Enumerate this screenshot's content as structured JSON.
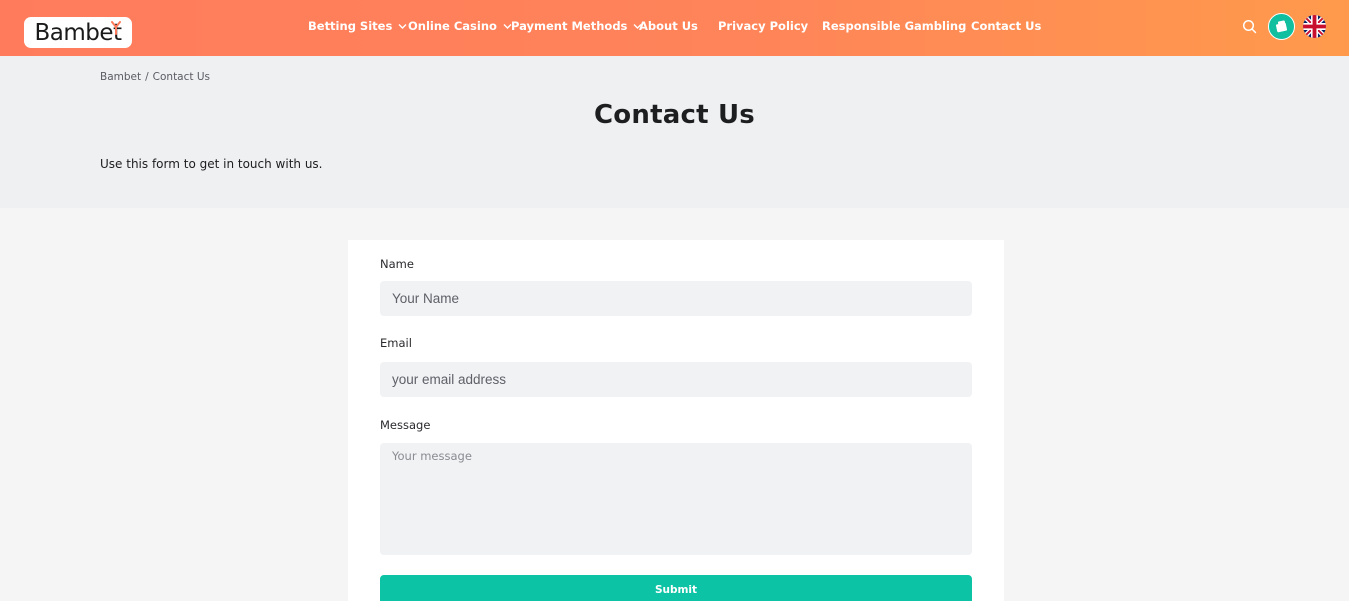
{
  "brand": {
    "logo_text": "Bambet"
  },
  "nav": {
    "items": [
      {
        "label": "Betting Sites",
        "has_dropdown": true
      },
      {
        "label": "Online Casino",
        "has_dropdown": true
      },
      {
        "label": "Payment Methods",
        "has_dropdown": true
      },
      {
        "label": "About Us",
        "has_dropdown": false
      },
      {
        "label": "Privacy Policy",
        "has_dropdown": false
      },
      {
        "label": "Responsible Gambling",
        "has_dropdown": false
      },
      {
        "label": "Contact Us",
        "has_dropdown": false
      }
    ],
    "icons": [
      "search-icon",
      "gift-icon",
      "uk-flag-icon"
    ]
  },
  "breadcrumb": {
    "home": "Bambet",
    "separator": "/",
    "current": "Contact Us"
  },
  "page": {
    "title": "Contact Us",
    "intro": "Use this form to get in touch with us."
  },
  "form": {
    "name": {
      "label": "Name",
      "placeholder": "Your Name",
      "value": ""
    },
    "email": {
      "label": "Email",
      "placeholder": "your email address",
      "value": ""
    },
    "message": {
      "label": "Message",
      "placeholder": "Your message",
      "value": ""
    },
    "submit_label": "Submit"
  },
  "colors": {
    "header_gradient_start": "#ff7b5c",
    "header_gradient_end": "#ff9a4c",
    "accent": "#0cc3a5",
    "hero_bg": "#eff0f2",
    "page_bg": "#f5f5f6",
    "input_bg": "#f1f2f4"
  }
}
